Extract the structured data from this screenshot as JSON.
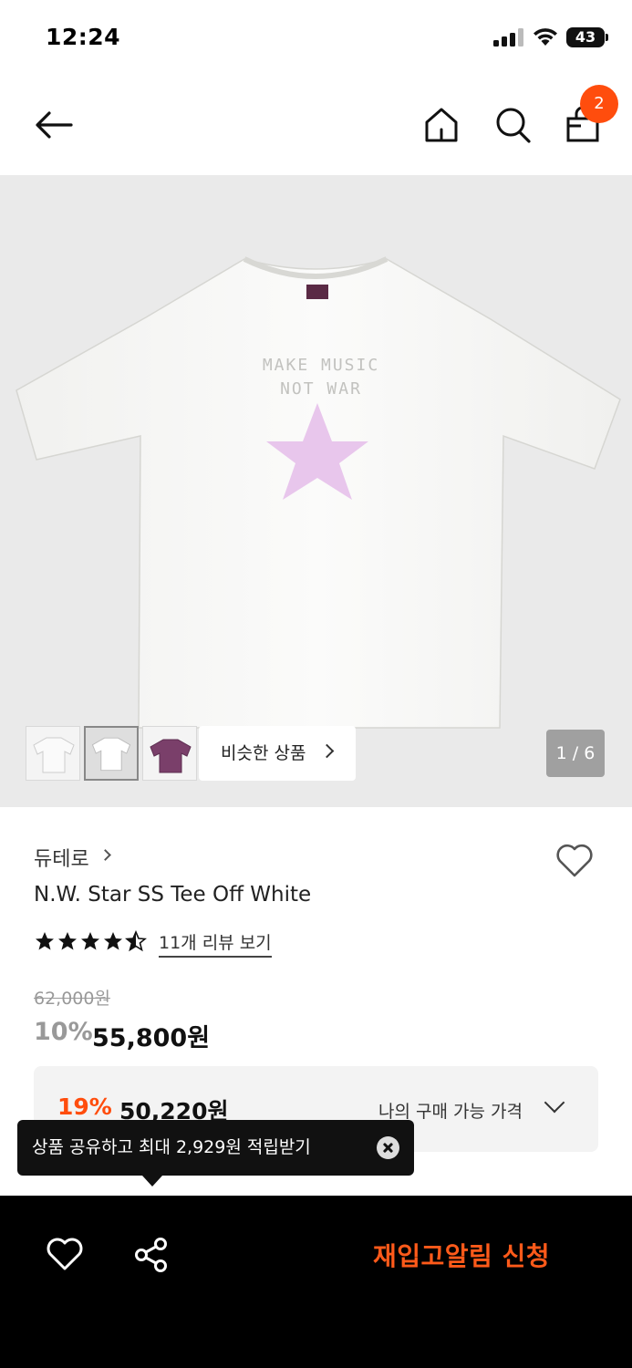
{
  "status_bar": {
    "time": "12:24",
    "battery": "43"
  },
  "nav": {
    "back_icon": "arrow-left-icon",
    "home_icon": "home-icon",
    "search_icon": "search-icon",
    "bag_icon": "shopping-bag-icon",
    "cart_count": "2"
  },
  "gallery": {
    "print_line1": "MAKE MUSIC",
    "print_line2": "NOT WAR",
    "similar_label": "비슷한 상품",
    "pager": "1 / 6",
    "thumbnails": [
      "white tee",
      "white tee back",
      "purple tee"
    ]
  },
  "product": {
    "brand": "듀테로",
    "name": "N.W. Star SS Tee Off White",
    "rating": 4.5,
    "reviews_label": "11개 리뷰 보기",
    "original_price": "62,000원",
    "discount": "10%",
    "price": "55,800원"
  },
  "my_price": {
    "discount": "19%",
    "amount": "50,220원",
    "label": "나의 구매 가능 가격"
  },
  "tooltip": {
    "text": "상품 공유하고 최대 2,929원 적립받기"
  },
  "bottom_bar": {
    "cta_label": "재입고알림 신청"
  },
  "colors": {
    "accent": "#ff4d0d",
    "star_print": "#e8c6ec",
    "image_bg": "#eaeaea"
  }
}
